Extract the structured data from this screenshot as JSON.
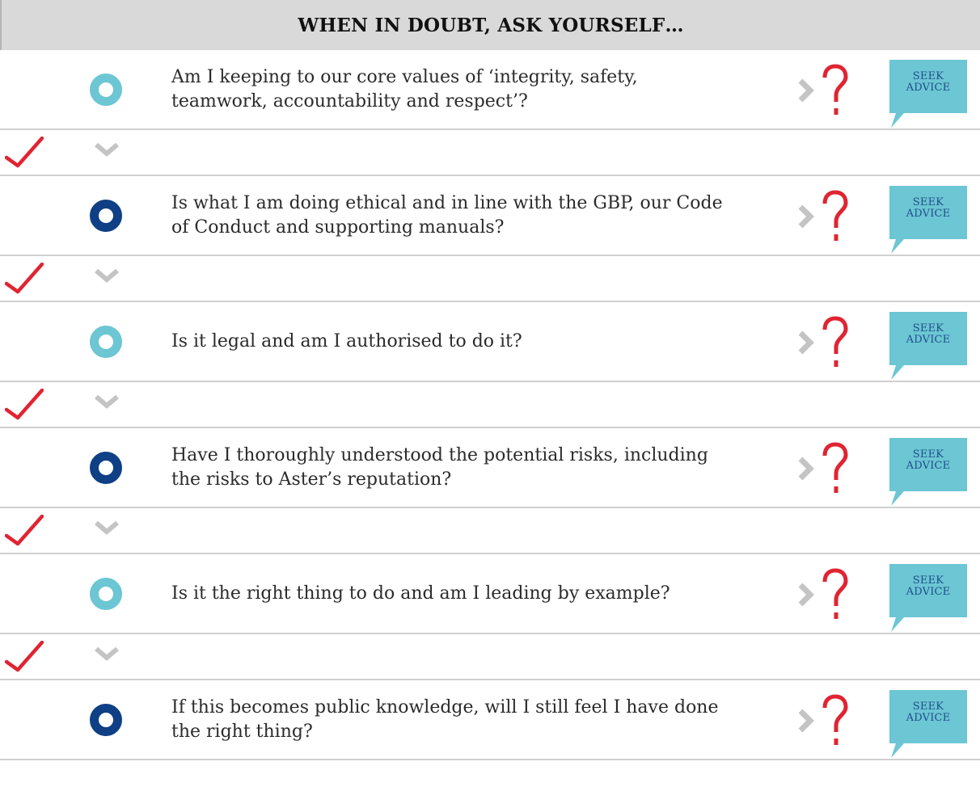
{
  "header": {
    "title": "WHEN IN DOUBT, ASK YOURSELF…"
  },
  "colors": {
    "light_ring": "#6cc6d3",
    "dark_ring": "#0f3f85",
    "check": "#e02432",
    "question_mark": "#e02432",
    "arrow": "#c4c4c4",
    "bubble": "#6cc6d3",
    "bubble_text": "#1e4f8a",
    "header_bg": "#d9d9d9"
  },
  "icons": {
    "ring": "ring-icon",
    "check": "checkmark-icon",
    "chevron": "chevron-down-icon",
    "arrow": "chevron-right-icon",
    "question": "question-mark-icon",
    "bubble": "speech-bubble-icon"
  },
  "questions": [
    {
      "lines": [
        "Am I keeping to our core values of ‘integrity, safety,",
        "teamwork, accountability and respect’?"
      ],
      "ring": "light",
      "advice": [
        "SEEK",
        "ADVICE"
      ]
    },
    {
      "lines": [
        "Is what I am doing ethical and in line with the GBP, our Code",
        "of Conduct and supporting manuals?"
      ],
      "ring": "dark",
      "advice": [
        "SEEK",
        "ADVICE"
      ]
    },
    {
      "lines": [
        "Is it legal and am I authorised to do it?"
      ],
      "ring": "light",
      "advice": [
        "SEEK",
        "ADVICE"
      ]
    },
    {
      "lines": [
        "Have I thoroughly understood the potential risks, including",
        "the risks to Aster’s reputation?"
      ],
      "ring": "dark",
      "advice": [
        "SEEK",
        "ADVICE"
      ]
    },
    {
      "lines": [
        "Is it the right thing to do and am I leading by example?"
      ],
      "ring": "light",
      "advice": [
        "SEEK",
        "ADVICE"
      ]
    },
    {
      "lines": [
        "If this becomes public knowledge, will I still feel I have done",
        "the right thing?"
      ],
      "ring": "dark",
      "advice": [
        "SEEK",
        "ADVICE"
      ]
    }
  ]
}
